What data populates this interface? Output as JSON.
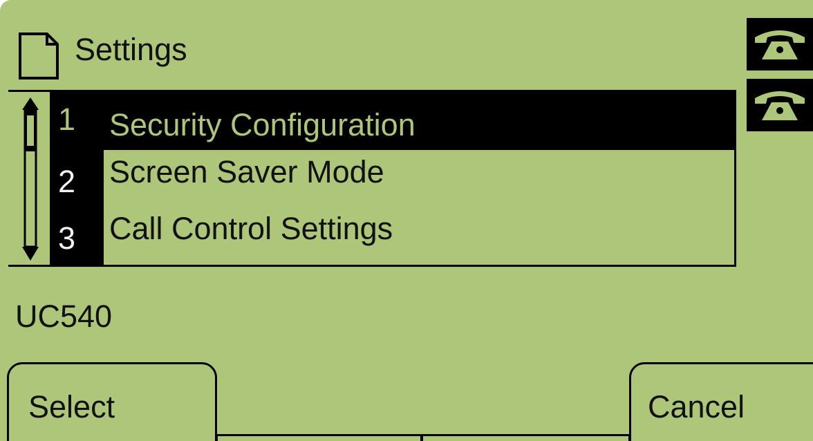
{
  "header": {
    "title": "Settings",
    "icon": "document-icon"
  },
  "lines": [
    {
      "icon": "phone-handset-icon"
    },
    {
      "icon": "phone-handset-icon"
    }
  ],
  "menu": {
    "items": [
      {
        "number": "1",
        "label": "Security Configuration",
        "selected": true
      },
      {
        "number": "2",
        "label": "Screen Saver Mode",
        "selected": false
      },
      {
        "number": "3",
        "label": "Call Control Settings",
        "selected": false
      }
    ]
  },
  "status": {
    "text": "UC540"
  },
  "softkeys": {
    "select": "Select",
    "cancel": "Cancel"
  },
  "colors": {
    "lcd_background": "#aec67a",
    "highlight": "#000000"
  }
}
